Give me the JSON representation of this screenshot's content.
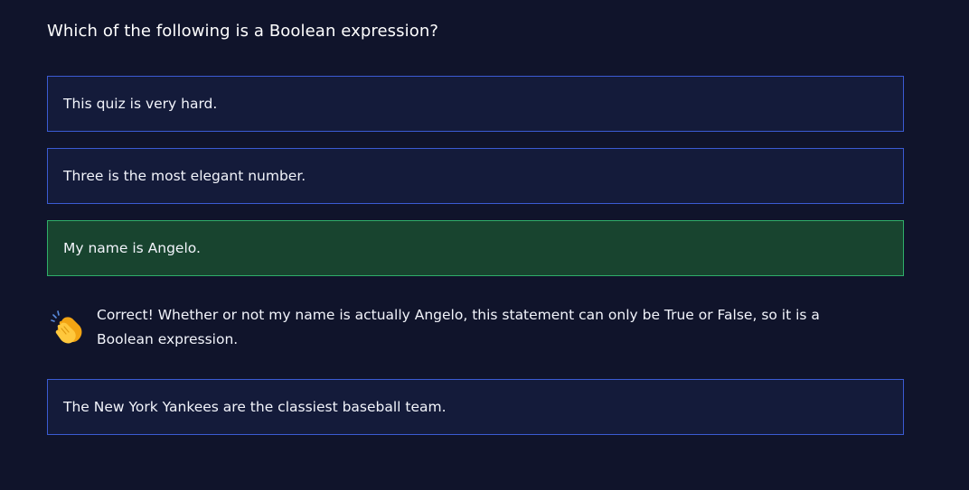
{
  "question": "Which of the following is a Boolean expression?",
  "options": [
    {
      "label": "This quiz is very hard."
    },
    {
      "label": "Three is the most elegant number."
    },
    {
      "label": "My name is Angelo."
    },
    {
      "label": "The New York Yankees are the classiest baseball team."
    }
  ],
  "feedback": {
    "icon": "clapping-hands-icon",
    "text": "Correct! Whether or not my name is actually Angelo, this statement can only be True or False, so it is a Boolean expression."
  },
  "colors": {
    "background": "#10142b",
    "option_border": "#3b5bd3",
    "option_bg": "#141b3a",
    "correct_bg": "#18442f",
    "correct_border": "#2fae6a"
  }
}
